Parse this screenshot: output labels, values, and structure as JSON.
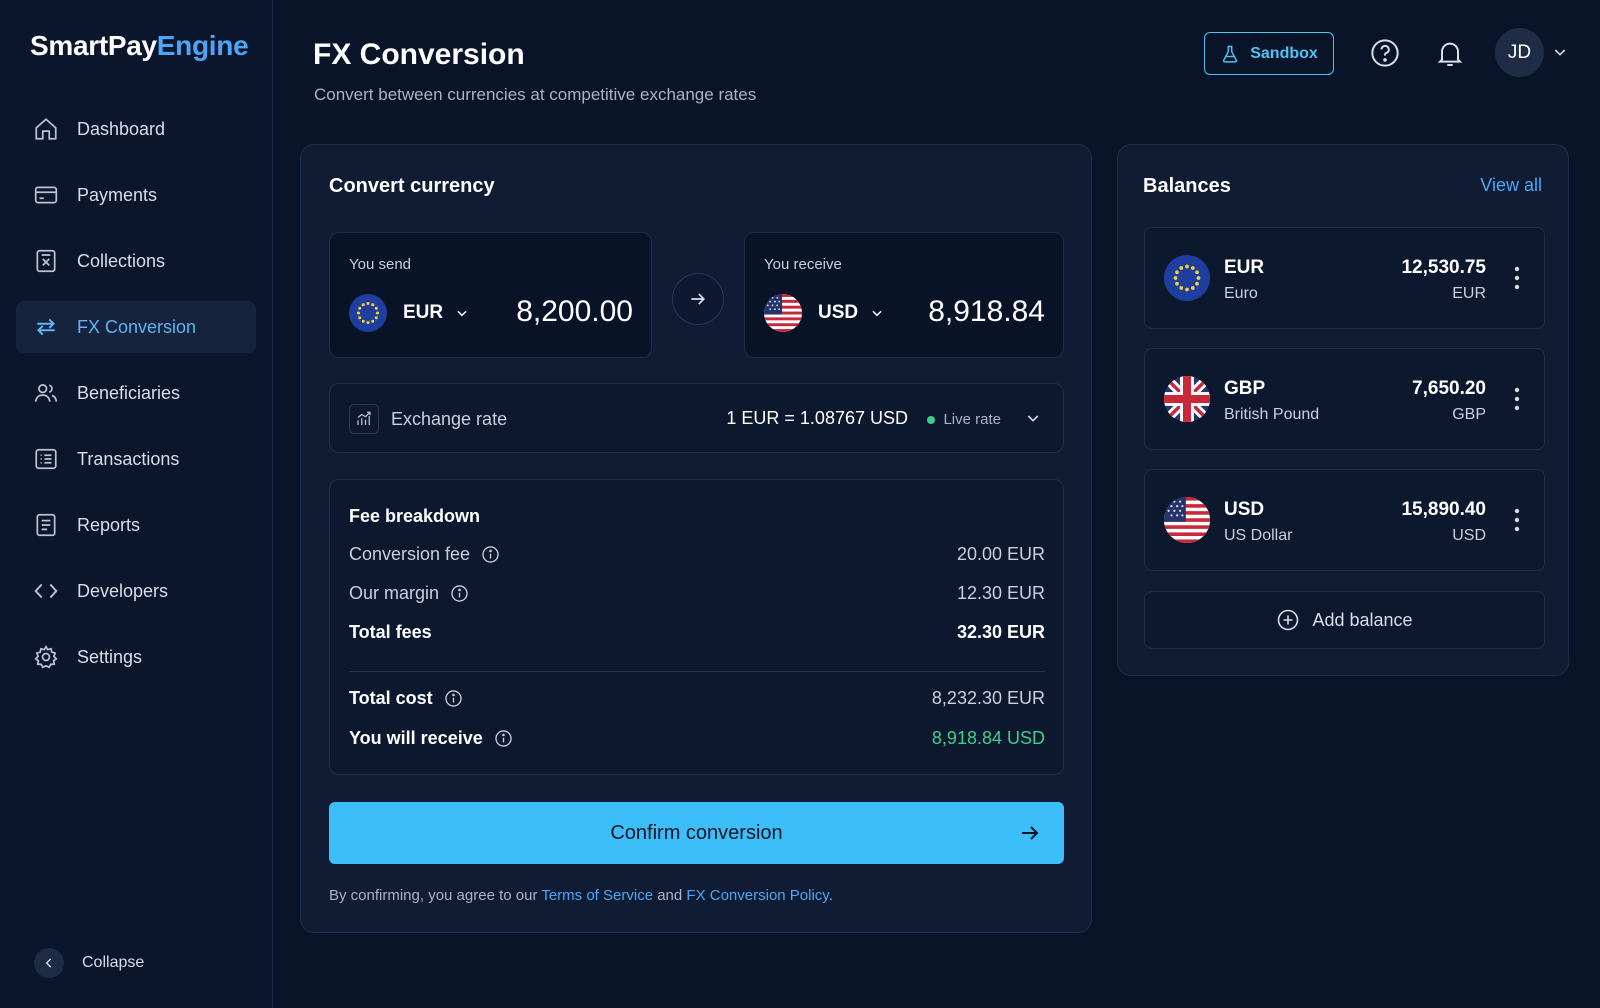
{
  "app": {
    "brand_a": "SmartPay",
    "brand_b": "Engine"
  },
  "sidebar": {
    "items": [
      {
        "label": "Dashboard",
        "icon": "home-icon"
      },
      {
        "label": "Payments",
        "icon": "card-icon"
      },
      {
        "label": "Collections",
        "icon": "collections-icon"
      },
      {
        "label": "FX Conversion",
        "icon": "swap-icon",
        "active": true
      },
      {
        "label": "Beneficiaries",
        "icon": "users-icon"
      },
      {
        "label": "Transactions",
        "icon": "list-icon"
      },
      {
        "label": "Reports",
        "icon": "report-icon"
      },
      {
        "label": "Developers",
        "icon": "code-icon"
      },
      {
        "label": "Settings",
        "icon": "gear-icon"
      }
    ],
    "collapse_label": "Collapse"
  },
  "header": {
    "title": "FX Conversion",
    "subtitle": "Convert between currencies at competitive exchange rates",
    "sandbox_label": "Sandbox",
    "avatar_initials": "JD"
  },
  "convert": {
    "title": "Convert currency",
    "send": {
      "label": "You send",
      "currency": "EUR",
      "amount": "8,200.00"
    },
    "receive": {
      "label": "You receive",
      "currency": "USD",
      "amount": "8,918.84"
    },
    "rate": {
      "label": "Exchange rate",
      "value": "1 EUR = 1.08767 USD",
      "status": "Live rate"
    },
    "fees": {
      "title": "Fee breakdown",
      "conversion_fee_label": "Conversion fee",
      "conversion_fee": "20.00 EUR",
      "margin_label": "Our margin",
      "margin": "12.30 EUR",
      "total_fees_label": "Total fees",
      "total_fees": "32.30 EUR",
      "total_cost_label": "Total cost",
      "total_cost": "8,232.30 EUR",
      "receive_label": "You will receive",
      "receive": "8,918.84 USD"
    },
    "confirm_label": "Confirm conversion",
    "terms": {
      "prefix": "By confirming, you agree to our ",
      "tos": "Terms of Service",
      "and": " and ",
      "policy": "FX Conversion Policy",
      "suffix": "."
    }
  },
  "balances": {
    "title": "Balances",
    "view_all": "View all",
    "items": [
      {
        "code": "EUR",
        "name": "Euro",
        "amount": "12,530.75",
        "currency": "EUR"
      },
      {
        "code": "GBP",
        "name": "British Pound",
        "amount": "7,650.20",
        "currency": "GBP"
      },
      {
        "code": "USD",
        "name": "US Dollar",
        "amount": "15,890.40",
        "currency": "USD"
      }
    ],
    "add_label": "Add balance"
  },
  "colors": {
    "accent": "#3cbff8",
    "link": "#4ca6f7",
    "positive": "#3ecf8e",
    "background": "#0a1428"
  }
}
